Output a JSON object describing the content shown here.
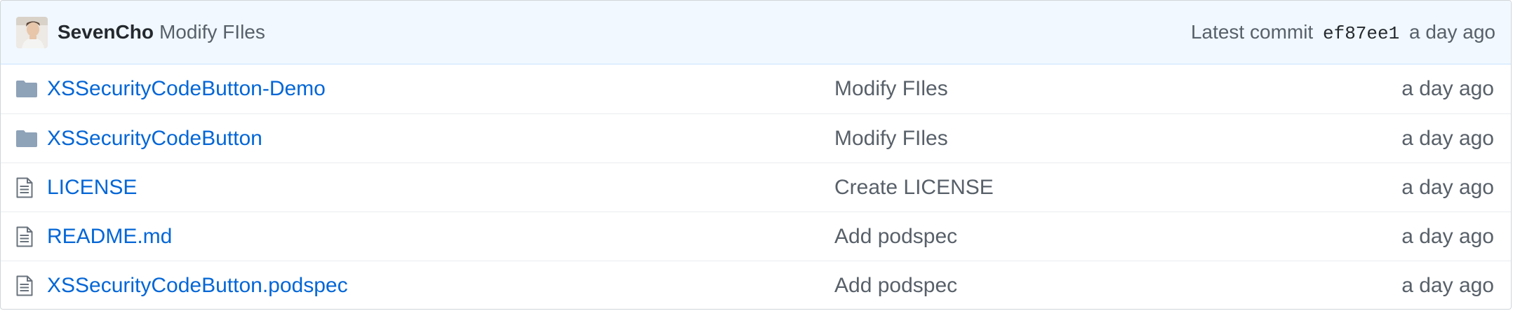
{
  "last_commit": {
    "author": "SevenCho",
    "message": "Modify FIles",
    "latest_label": "Latest commit",
    "sha": "ef87ee1",
    "age": "a day ago",
    "avatar_icon": "user-avatar-photo"
  },
  "files": [
    {
      "type": "directory",
      "icon": "folder-icon",
      "name": "XSSecurityCodeButton-Demo",
      "message": "Modify FIles",
      "age": "a day ago"
    },
    {
      "type": "directory",
      "icon": "folder-icon",
      "name": "XSSecurityCodeButton",
      "message": "Modify FIles",
      "age": "a day ago"
    },
    {
      "type": "file",
      "icon": "file-text-icon",
      "name": "LICENSE",
      "message": "Create LICENSE",
      "age": "a day ago"
    },
    {
      "type": "file",
      "icon": "file-text-icon",
      "name": "README.md",
      "message": "Add podspec",
      "age": "a day ago"
    },
    {
      "type": "file",
      "icon": "file-text-icon",
      "name": "XSSecurityCodeButton.podspec",
      "message": "Add podspec",
      "age": "a day ago"
    }
  ],
  "colors": {
    "link": "#0366d6",
    "muted": "#586069",
    "header_bg": "#f1f8ff",
    "icon": "#8ea2b8"
  }
}
